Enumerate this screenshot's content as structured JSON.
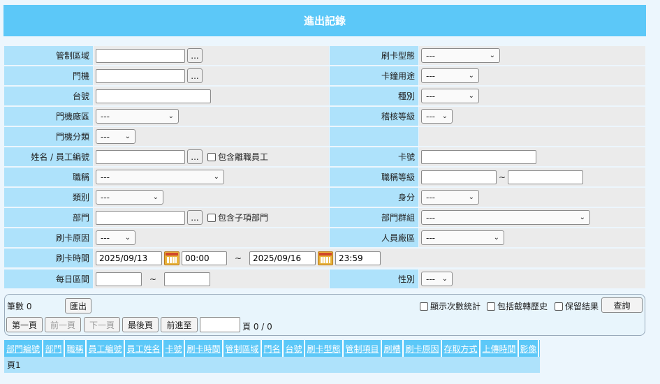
{
  "title": "進出記錄",
  "form": {
    "control_area": {
      "label": "管制區域",
      "value": ""
    },
    "card_type": {
      "label": "刷卡型態",
      "value": "---"
    },
    "door": {
      "label": "門機",
      "value": ""
    },
    "card_purpose": {
      "label": "卡鐘用途",
      "value": "---"
    },
    "terminal_no": {
      "label": "台號",
      "value": ""
    },
    "category": {
      "label": "種別",
      "value": "---"
    },
    "door_area": {
      "label": "門機廠區",
      "value": "---"
    },
    "audit_level": {
      "label": "稽核等級",
      "value": "---"
    },
    "door_class": {
      "label": "門機分類",
      "value": "---"
    },
    "name_emp": {
      "label": "姓名 / 員工編號",
      "value": "",
      "checkbox": "包含離職員工"
    },
    "card_no": {
      "label": "卡號",
      "value": ""
    },
    "job_title": {
      "label": "職稱",
      "value": "---"
    },
    "title_level": {
      "label": "職稱等級",
      "from": "",
      "to": "",
      "sep": "~"
    },
    "type": {
      "label": "類別",
      "value": "---"
    },
    "identity": {
      "label": "身分",
      "value": "---"
    },
    "dept": {
      "label": "部門",
      "value": "",
      "checkbox": "包含子項部門"
    },
    "dept_group": {
      "label": "部門群組",
      "value": "---"
    },
    "reason": {
      "label": "刷卡原因",
      "value": "---"
    },
    "person_area": {
      "label": "人員廠區",
      "value": "---"
    },
    "swipe_time": {
      "label": "刷卡時間",
      "start_date": "2025/09/13",
      "start_time": "00:00",
      "sep": "~",
      "end_date": "2025/09/16",
      "end_time": "23:59"
    },
    "daily_range": {
      "label": "每日區間",
      "from": "",
      "to": "",
      "sep": "~"
    },
    "gender": {
      "label": "性別",
      "value": "---"
    },
    "dots": "..."
  },
  "toolbar": {
    "count_label": "筆數",
    "count": "0",
    "export": "匯出",
    "show_stats": "顯示次數統計",
    "include_history": "包括截轉歷史",
    "keep_results": "保留結果",
    "query": "查詢",
    "first": "第一頁",
    "prev": "前一頁",
    "next": "下一頁",
    "last": "最後頁",
    "goto": "前進至",
    "page_label": "頁 0 / 0"
  },
  "grid": {
    "columns": [
      "部門編號",
      "部門",
      "職稱",
      "員工編號",
      "員工姓名",
      "卡號",
      "刷卡時間",
      "管制區域",
      "門名",
      "台號",
      "刷卡型態",
      "管制項目",
      "刷槽",
      "刷卡原因",
      "存取方式",
      "上傳時間",
      "影像"
    ],
    "footer": "頁1"
  }
}
